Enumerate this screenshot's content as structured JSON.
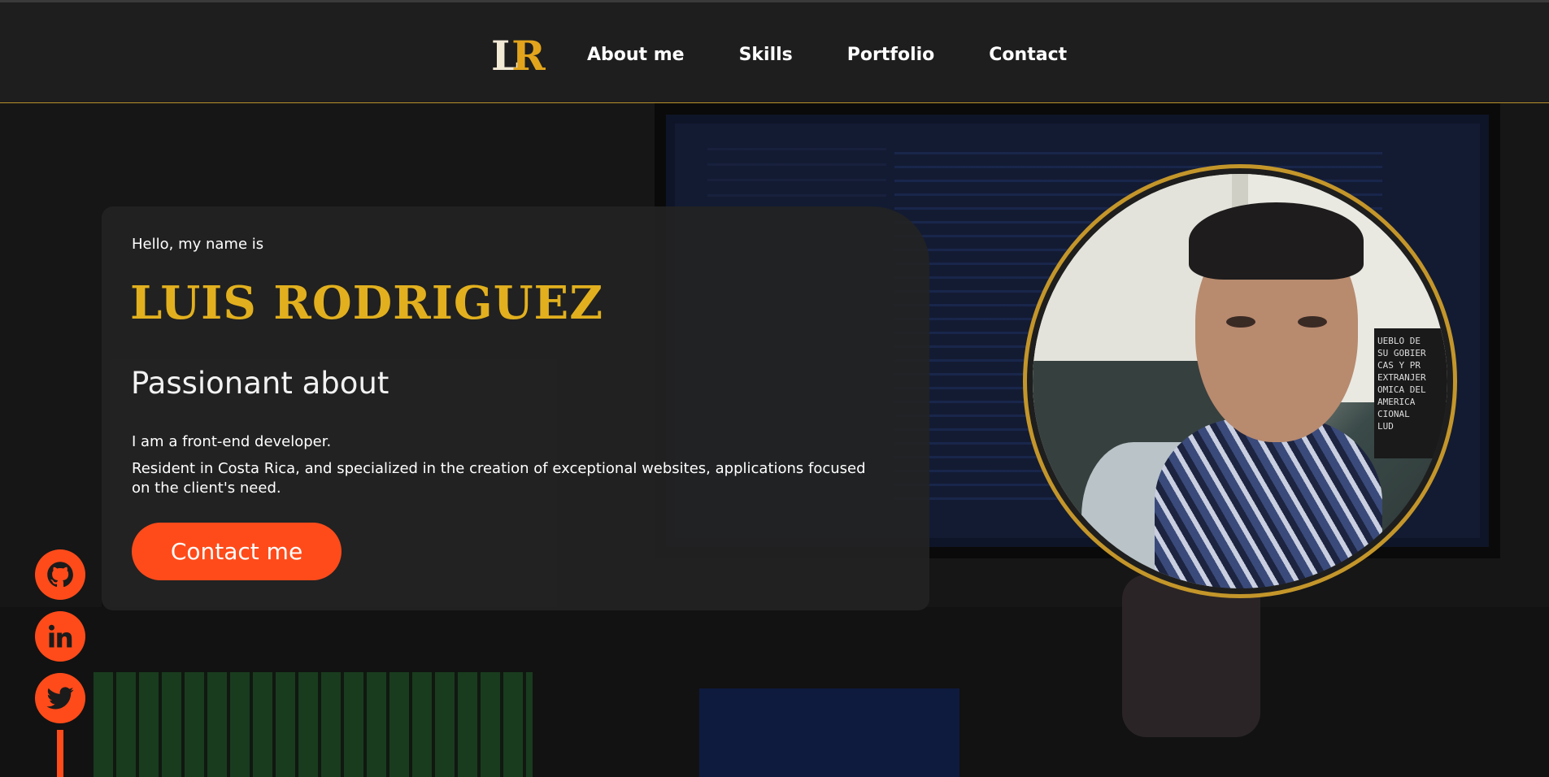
{
  "header": {
    "logo": {
      "left": "L",
      "right": "R"
    },
    "nav": [
      "About me",
      "Skills",
      "Portfolio",
      "Contact"
    ]
  },
  "hero": {
    "greeting": "Hello, my name is",
    "name": "LUIS RODRIGUEZ",
    "tagline": "Passionant about",
    "description_line1": "I am a front-end developer.",
    "description_line2": "Resident in Costa Rica, and specialized in the creation of exceptional websites, applications focused on the client's need.",
    "cta_label": "Contact me"
  },
  "photo_sign_text": "UEBLO DE\nSU GOBIER\nCAS Y PR\nEXTRANJER\nOMICA DEL\nAMERICA\nCIONAL\nLUD",
  "social": [
    {
      "icon": "github-icon"
    },
    {
      "icon": "linkedin-icon"
    },
    {
      "icon": "twitter-icon"
    }
  ],
  "colors": {
    "accent": "#ff4b1a",
    "gold": "#e2b01e",
    "background": "#1b1b1b"
  }
}
